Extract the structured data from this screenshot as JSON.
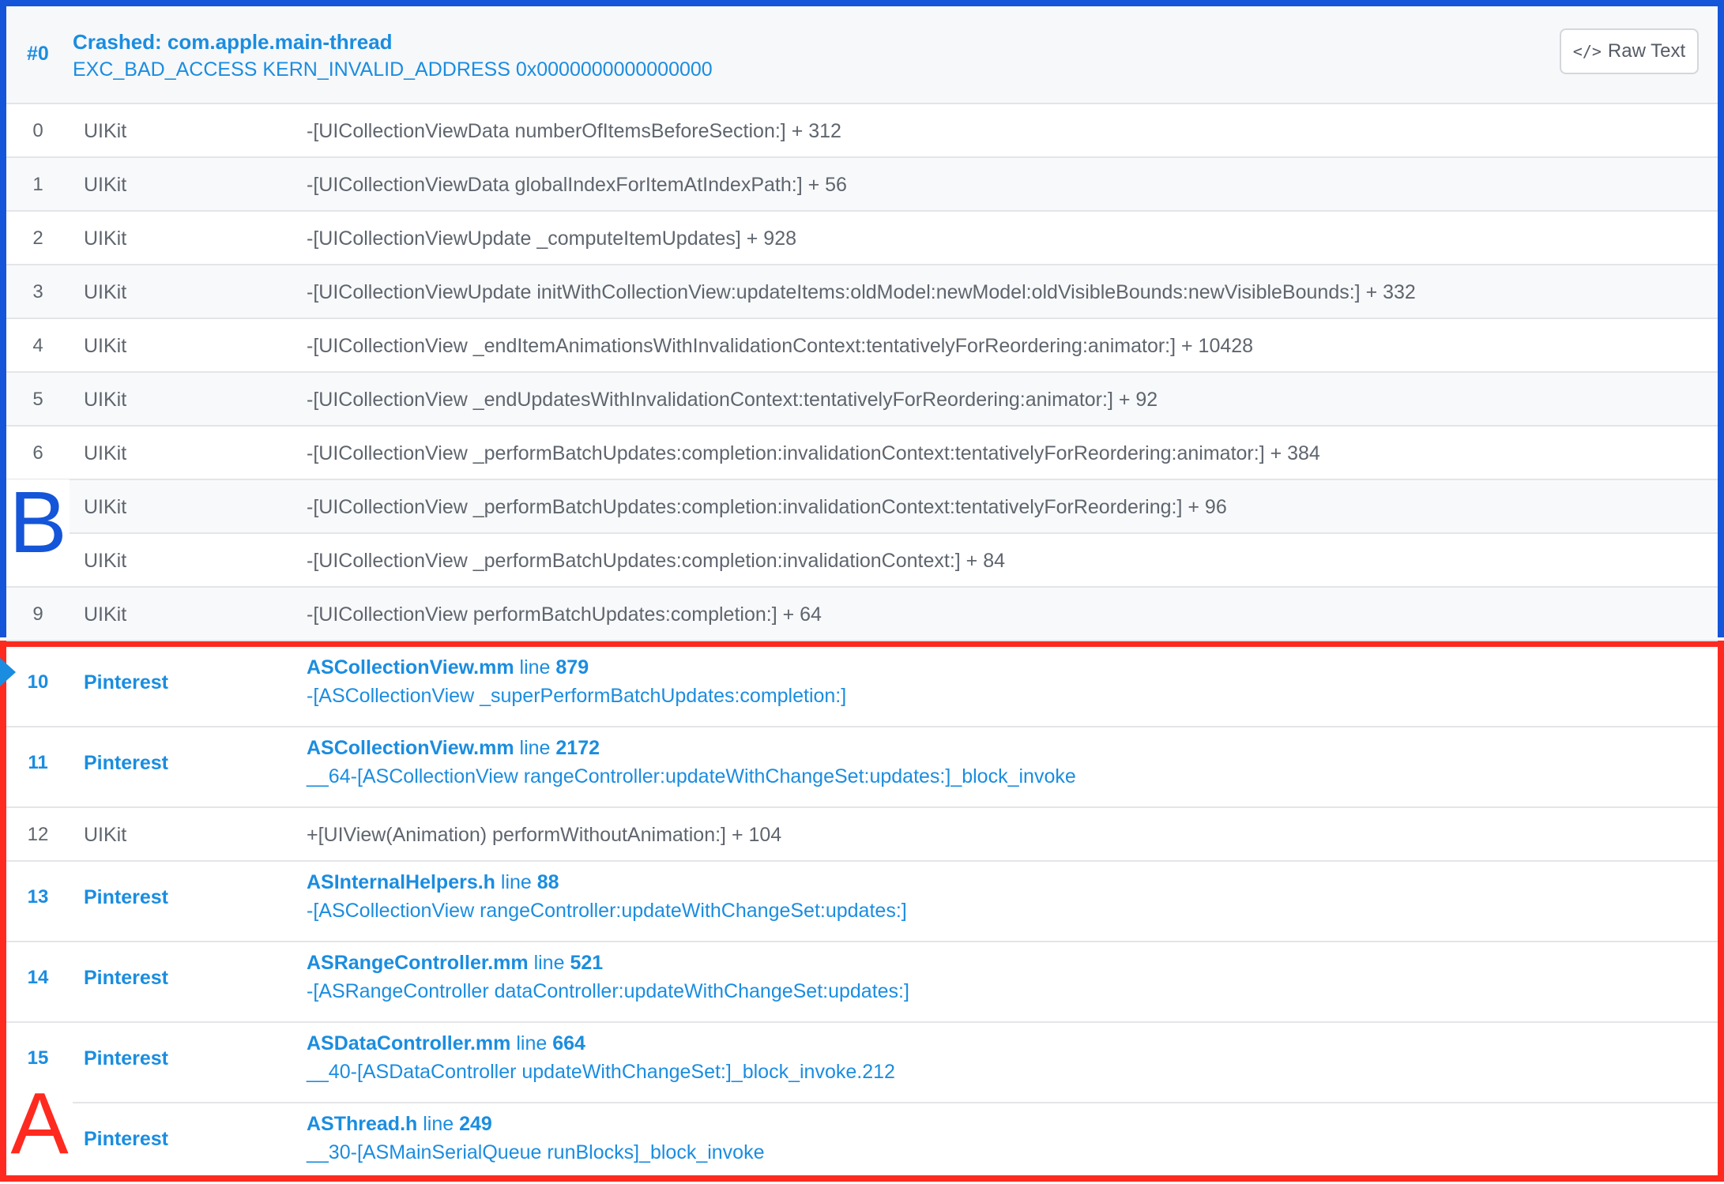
{
  "header": {
    "index": "#0",
    "title": "Crashed: com.apple.main-thread",
    "reason": "EXC_BAD_ACCESS KERN_INVALID_ADDRESS 0x0000000000000000",
    "raw_button_label": "Raw Text",
    "raw_button_icon": "code-icon"
  },
  "system_frames": [
    {
      "num": "0",
      "lib": "UIKit",
      "symbol": "-[UICollectionViewData numberOfItemsBeforeSection:] + 312"
    },
    {
      "num": "1",
      "lib": "UIKit",
      "symbol": "-[UICollectionViewData globalIndexForItemAtIndexPath:] + 56"
    },
    {
      "num": "2",
      "lib": "UIKit",
      "symbol": "-[UICollectionViewUpdate _computeItemUpdates] + 928"
    },
    {
      "num": "3",
      "lib": "UIKit",
      "symbol": "-[UICollectionViewUpdate initWithCollectionView:updateItems:oldModel:newModel:oldVisibleBounds:newVisibleBounds:] + 332"
    },
    {
      "num": "4",
      "lib": "UIKit",
      "symbol": "-[UICollectionView _endItemAnimationsWithInvalidationContext:tentativelyForReordering:animator:] + 10428"
    },
    {
      "num": "5",
      "lib": "UIKit",
      "symbol": "-[UICollectionView _endUpdatesWithInvalidationContext:tentativelyForReordering:animator:] + 92"
    },
    {
      "num": "6",
      "lib": "UIKit",
      "symbol": "-[UICollectionView _performBatchUpdates:completion:invalidationContext:tentativelyForReordering:animator:] + 384"
    },
    {
      "num": "",
      "lib": "UIKit",
      "symbol": "-[UICollectionView _performBatchUpdates:completion:invalidationContext:tentativelyForReordering:] + 96"
    },
    {
      "num": "",
      "lib": "UIKit",
      "symbol": "-[UICollectionView _performBatchUpdates:completion:invalidationContext:] + 84"
    },
    {
      "num": "9",
      "lib": "UIKit",
      "symbol": "-[UICollectionView performBatchUpdates:completion:] + 64"
    }
  ],
  "lower_frames": [
    {
      "kind": "app",
      "num": "10",
      "lib": "Pinterest",
      "file": "ASCollectionView.mm",
      "line_word": "line",
      "line": "879",
      "function": "-[ASCollectionView _superPerformBatchUpdates:completion:]",
      "selected": true
    },
    {
      "kind": "app",
      "num": "11",
      "lib": "Pinterest",
      "file": "ASCollectionView.mm",
      "line_word": "line",
      "line": "2172",
      "function": "__64-[ASCollectionView rangeController:updateWithChangeSet:updates:]_block_invoke"
    },
    {
      "kind": "sys",
      "num": "12",
      "lib": "UIKit",
      "symbol": "+[UIView(Animation) performWithoutAnimation:] + 104"
    },
    {
      "kind": "app",
      "num": "13",
      "lib": "Pinterest",
      "file": "ASInternalHelpers.h",
      "line_word": "line",
      "line": "88",
      "function": "-[ASCollectionView rangeController:updateWithChangeSet:updates:]"
    },
    {
      "kind": "app",
      "num": "14",
      "lib": "Pinterest",
      "file": "ASRangeController.mm",
      "line_word": "line",
      "line": "521",
      "function": "-[ASRangeController dataController:updateWithChangeSet:updates:]"
    },
    {
      "kind": "app",
      "num": "15",
      "lib": "Pinterest",
      "file": "ASDataController.mm",
      "line_word": "line",
      "line": "664",
      "function": "__40-[ASDataController updateWithChangeSet:]_block_invoke.212"
    },
    {
      "kind": "app",
      "num": "",
      "lib": "Pinterest",
      "file": "ASThread.h",
      "line_word": "line",
      "line": "249",
      "function": "__30-[ASMainSerialQueue runBlocks]_block_invoke"
    }
  ],
  "annotations": {
    "label_b": "B",
    "label_a": "A",
    "color_b": "#1455d9",
    "color_a": "#ff2a1f"
  },
  "colors": {
    "accent": "#1a8de0",
    "system_text": "#5f656e",
    "header_bg": "#f7f8fa"
  }
}
